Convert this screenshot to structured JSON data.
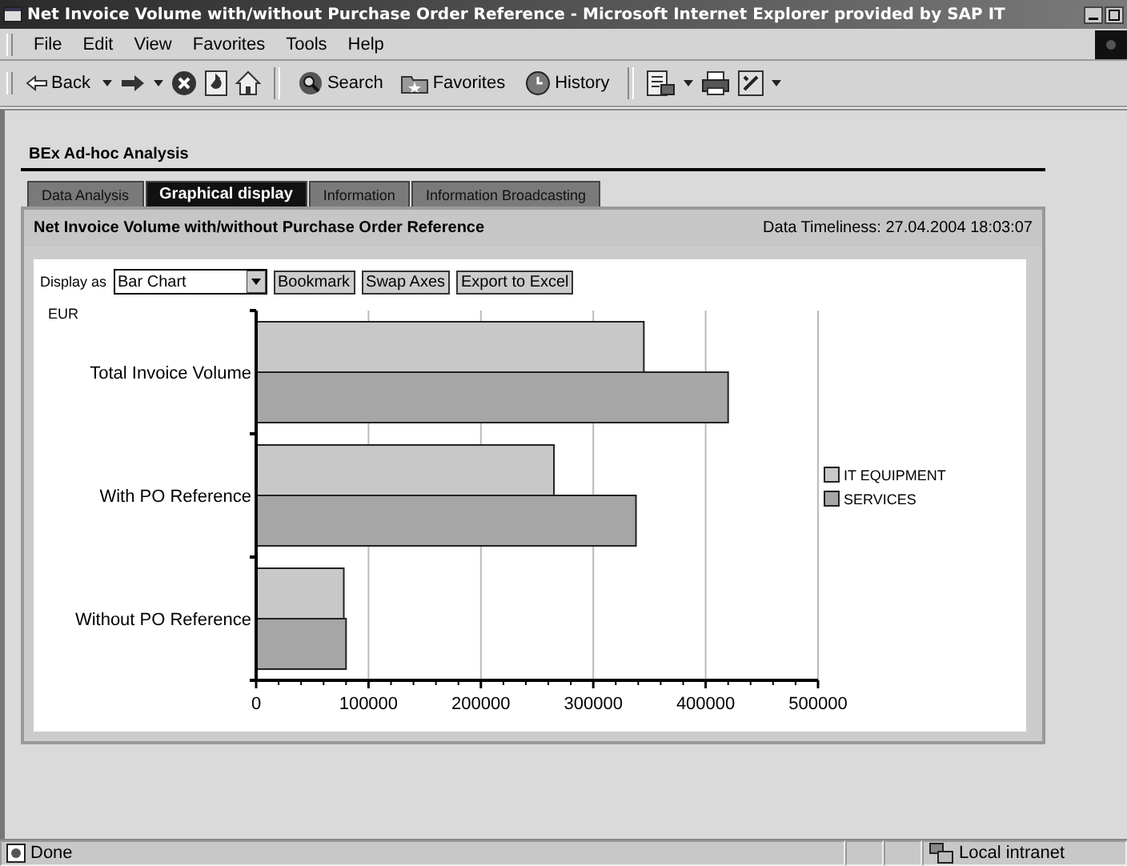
{
  "window": {
    "title": "Net Invoice Volume with/without Purchase Order Reference - Microsoft Internet Explorer provided by SAP IT"
  },
  "menu": [
    "File",
    "Edit",
    "View",
    "Favorites",
    "Tools",
    "Help"
  ],
  "toolbar": [
    {
      "kind": "back",
      "label": "Back"
    },
    {
      "kind": "forward"
    },
    {
      "kind": "stop"
    },
    {
      "kind": "refresh"
    },
    {
      "kind": "home"
    },
    {
      "kind": "search",
      "label": "Search"
    },
    {
      "kind": "favorites",
      "label": "Favorites"
    },
    {
      "kind": "history",
      "label": "History"
    },
    {
      "kind": "mail"
    },
    {
      "kind": "print"
    },
    {
      "kind": "edit"
    }
  ],
  "page": {
    "heading": "BEx Ad-hoc Analysis",
    "tabs": [
      {
        "label": "Data Analysis",
        "selected": false
      },
      {
        "label": "Graphical display",
        "selected": true
      },
      {
        "label": "Information",
        "selected": false
      },
      {
        "label": "Information Broadcasting",
        "selected": false
      }
    ],
    "panel": {
      "title": "Net Invoice Volume with/without Purchase Order Reference",
      "timeliness": "Data Timeliness: 27.04.2004 18:03:07",
      "display_label": "Display as",
      "display_value": "Bar Chart",
      "buttons": [
        "Bookmark",
        "Swap Axes",
        "Export to Excel"
      ],
      "chart_data": {
        "type": "bar",
        "orientation": "horizontal",
        "ylabel": "EUR",
        "categories": [
          "Total Invoice Volume",
          "With PO Reference",
          "Without PO Reference"
        ],
        "series": [
          {
            "name": "IT EQUIPMENT",
            "color": "#c8c8c8",
            "values": [
              345000,
              265000,
              78000
            ]
          },
          {
            "name": "SERVICES",
            "color": "#a6a6a6",
            "values": [
              420000,
              338000,
              80000
            ]
          }
        ],
        "grid": true,
        "legend": true,
        "xlim": [
          0,
          500000
        ],
        "xticks": [
          0,
          100000,
          200000,
          300000,
          400000,
          500000
        ]
      }
    }
  },
  "status_bar": {
    "text": "Done",
    "zone": "Local intranet"
  }
}
